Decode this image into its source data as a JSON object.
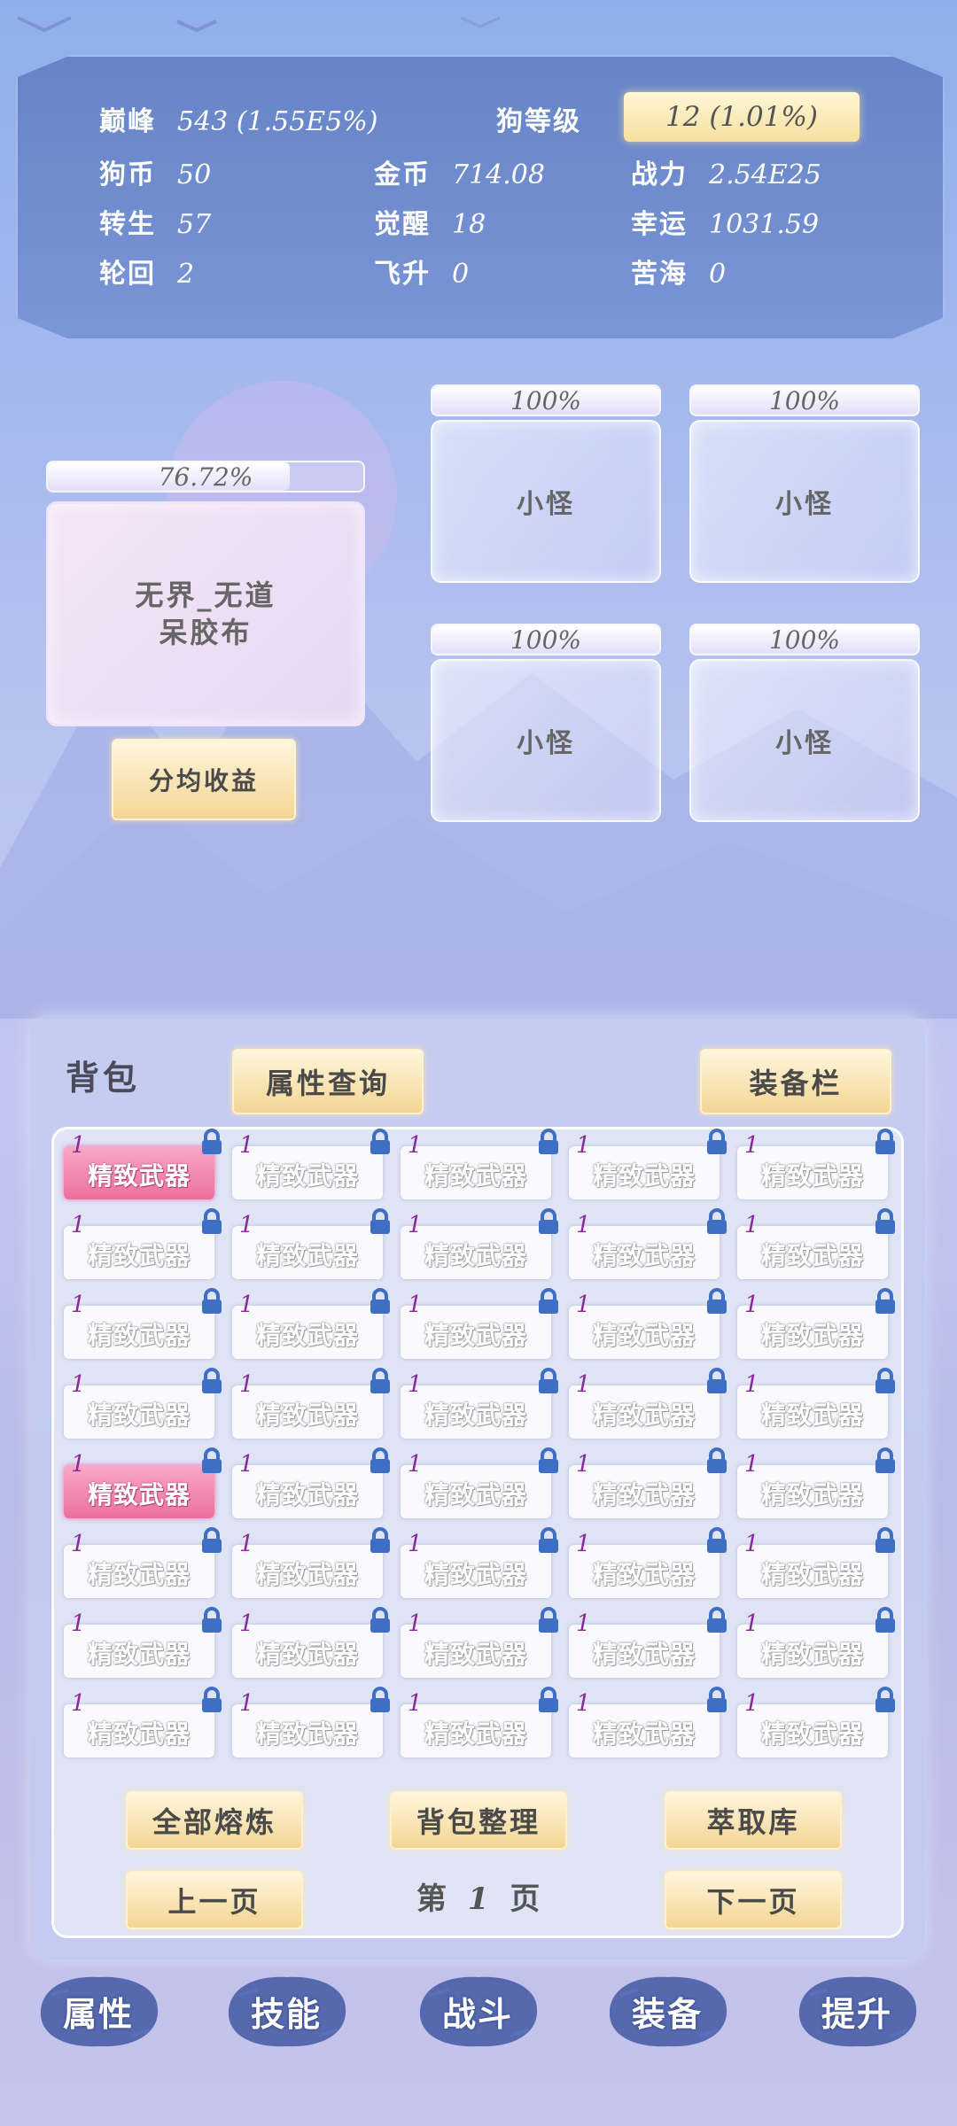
{
  "stats": {
    "peak_label": "巅峰",
    "peak_value": "543 (1.55E5%)",
    "dog_level_label": "狗等级",
    "dog_level_value": "12 (1.01%)",
    "dog_coin_label": "狗币",
    "dog_coin_value": "50",
    "gold_label": "金币",
    "gold_value": "714.08",
    "power_label": "战力",
    "power_value": "2.54E25",
    "rebirth_label": "转生",
    "rebirth_value": "57",
    "awaken_label": "觉醒",
    "awaken_value": "18",
    "luck_label": "幸运",
    "luck_value": "1031.59",
    "reincarnate_label": "轮回",
    "reincarnate_value": "2",
    "ascend_label": "飞升",
    "ascend_value": "0",
    "suffering_label": "苦海",
    "suffering_value": "0"
  },
  "boss": {
    "hp_text": "76.72%",
    "hp_fraction": 0.7672,
    "name_line1": "无界_无道",
    "name_line2": "呆胶布"
  },
  "share_button": "分均收益",
  "monsters": [
    {
      "hp_text": "100%",
      "hp_fraction": 1.0,
      "name": "小怪"
    },
    {
      "hp_text": "100%",
      "hp_fraction": 1.0,
      "name": "小怪"
    },
    {
      "hp_text": "100%",
      "hp_fraction": 1.0,
      "name": "小怪"
    },
    {
      "hp_text": "100%",
      "hp_fraction": 1.0,
      "name": "小怪"
    }
  ],
  "bag": {
    "title": "背包",
    "attr_query": "属性查询",
    "equip_bar": "装备栏",
    "item_name": "精致武器",
    "item_count": "1",
    "smelt_all": "全部熔炼",
    "sort_bag": "背包整理",
    "extract": "萃取库",
    "prev_page": "上一页",
    "page_prefix": "第",
    "page_num": "1",
    "page_suffix": "页",
    "next_page": "下一页"
  },
  "nav": [
    "属性",
    "技能",
    "战斗",
    "装备",
    "提升"
  ],
  "colors": {
    "pink_item": "#ec6f9e",
    "lock": "#3f6fc4",
    "gold_button": "#f4d594"
  }
}
